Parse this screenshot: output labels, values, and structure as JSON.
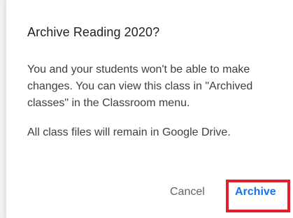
{
  "dialog": {
    "title": "Archive Reading 2020?",
    "paragraph_1": "You and your students won't be able to make changes. You can view this class in \"Archived classes\" in the Classroom menu.",
    "paragraph_2": "All class files will remain in Google Drive.",
    "cancel_label": "Cancel",
    "archive_label": "Archive"
  },
  "colors": {
    "accent": "#1a73e8",
    "highlight": "#e0202e",
    "text_primary": "#202124",
    "text_secondary": "#5f6368"
  }
}
